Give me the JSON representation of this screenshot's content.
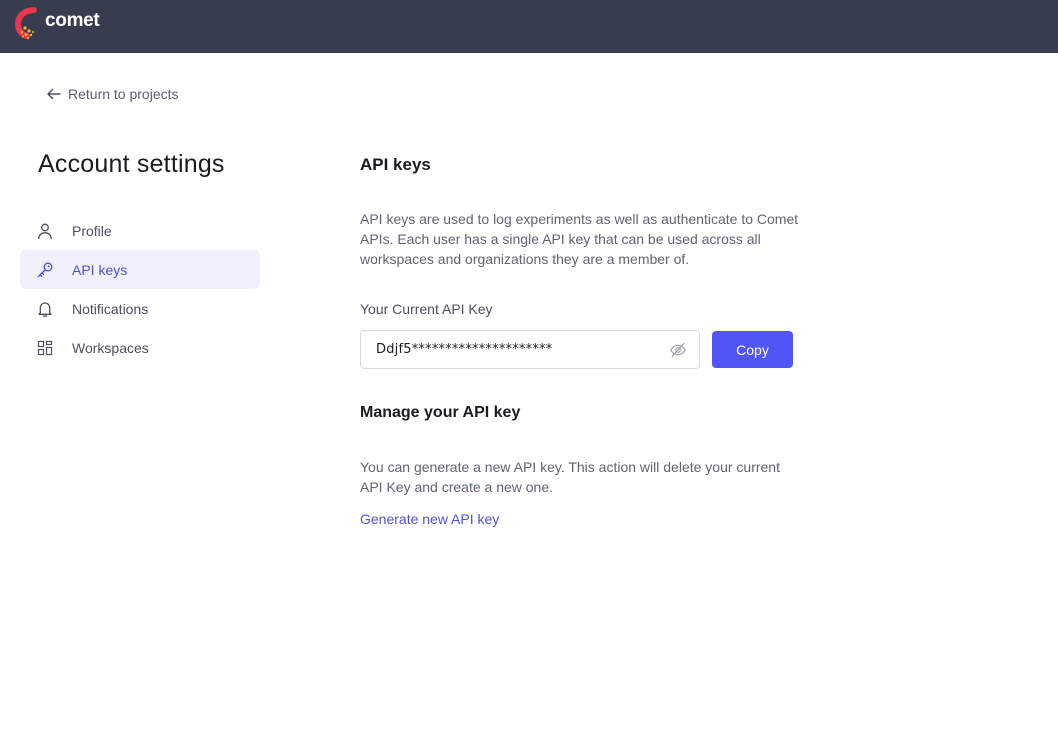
{
  "header": {
    "brand": "comet",
    "logo_icon": "comet-logo-icon",
    "bg_color": "#373d4f"
  },
  "back_link": {
    "label": "Return to projects",
    "icon": "arrow-left-icon"
  },
  "page": {
    "title": "Account settings"
  },
  "sidebar": {
    "items": [
      {
        "label": "Profile",
        "icon": "user-icon",
        "active": false
      },
      {
        "label": "API keys",
        "icon": "key-icon",
        "active": true
      },
      {
        "label": "Notifications",
        "icon": "bell-icon",
        "active": false
      },
      {
        "label": "Workspaces",
        "icon": "workspaces-grid-icon",
        "active": false
      }
    ],
    "active_color": "#4c4ecf",
    "active_bg": "#f1f1fd"
  },
  "api_keys": {
    "title": "API keys",
    "description": "API keys are used to log experiments as well as authenticate to Comet APIs. Each user has a single API key that can be used across all workspaces and organizations they are a member of.",
    "current_key_label": "Your Current API Key",
    "current_key_value": "Ddjf5*********************",
    "visibility_icon": "eye-off-icon",
    "copy_label": "Copy",
    "button_color": "#5155f5"
  },
  "manage": {
    "title": "Manage your API key",
    "description": "You can generate a new API key. This action will delete your current API Key and create a new one.",
    "generate_label": "Generate new API key",
    "link_color": "#4e51df"
  }
}
